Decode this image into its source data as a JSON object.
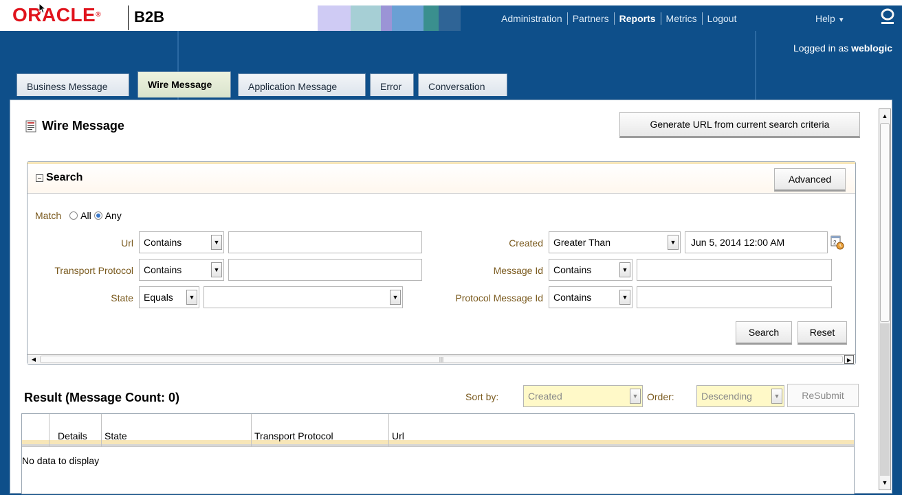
{
  "header": {
    "logo": "ORACLE",
    "product": "B2B",
    "nav": [
      "Administration",
      "Partners",
      "Reports",
      "Metrics"
    ],
    "logout": "Logout",
    "help": "Help",
    "logged_in_prefix": "Logged in as",
    "username": "weblogic"
  },
  "tabs": [
    "Business Message",
    "Wire Message",
    "Application Message",
    "Error",
    "Conversation"
  ],
  "page": {
    "title": "Wire Message",
    "generate_url_label": "Generate URL from current search criteria"
  },
  "search": {
    "title": "Search",
    "advanced_label": "Advanced",
    "match_label": "Match",
    "match_all": "All",
    "match_any": "Any",
    "url_label": "Url",
    "url_op": "Contains",
    "url_value": "",
    "transport_label": "Transport Protocol",
    "transport_op": "Contains",
    "transport_value": "",
    "state_label": "State",
    "state_op": "Equals",
    "state_value": "",
    "created_label": "Created",
    "created_op": "Greater Than",
    "created_value": "Jun 5, 2014 12:00 AM",
    "msgid_label": "Message Id",
    "msgid_op": "Contains",
    "msgid_value": "",
    "protomsgid_label": "Protocol Message Id",
    "protomsgid_op": "Contains",
    "protomsgid_value": "",
    "search_btn": "Search",
    "reset_btn": "Reset"
  },
  "result": {
    "title": "Result (Message Count: 0)",
    "sortby_label": "Sort by:",
    "sortby_value": "Created",
    "order_label": "Order:",
    "order_value": "Descending",
    "resubmit_label": "ReSubmit",
    "columns": [
      "Details",
      "State",
      "Transport Protocol",
      "Url"
    ],
    "empty_text": "No data to display"
  },
  "colors": {
    "brand_red": "#e0131c",
    "band_blue": "#0e4f8a",
    "label_brown": "#7a5a1e"
  }
}
